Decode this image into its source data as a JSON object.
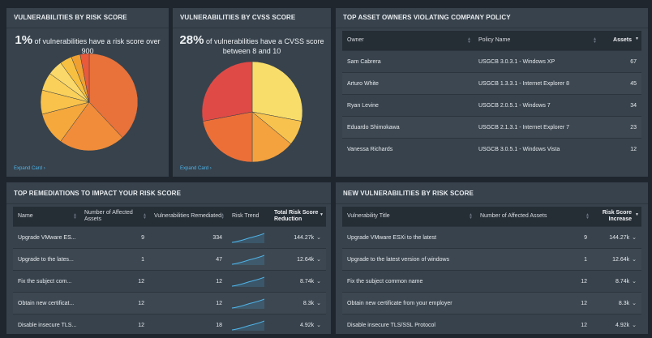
{
  "cards": {
    "risk_score": {
      "title": "VULNERABILITIES BY RISK SCORE",
      "stat_value": "1%",
      "stat_text": " of vulnerabilities have a risk score over 900",
      "expand_label": "Expand Card ›",
      "slices": [
        {
          "value": 38,
          "color": "#e8723a"
        },
        {
          "value": 22,
          "color": "#f08c3a"
        },
        {
          "value": 11,
          "color": "#f5a83c"
        },
        {
          "value": 8,
          "color": "#f9c24a"
        },
        {
          "value": 6,
          "color": "#fbd05a"
        },
        {
          "value": 5,
          "color": "#fbd86a"
        },
        {
          "value": 4,
          "color": "#f8c040"
        },
        {
          "value": 3,
          "color": "#f0a030"
        },
        {
          "value": 3,
          "color": "#e85a3a"
        }
      ]
    },
    "cvss_score": {
      "title": "VULNERABILITIES BY CVSS SCORE",
      "stat_value": "28%",
      "stat_text_line1": " of vulnerabilities have a CVSS score",
      "stat_text_line2": "between 8 and 10",
      "expand_label": "Expand Card ›",
      "slices": [
        {
          "value": 28,
          "color": "#f9dd6a"
        },
        {
          "value": 8,
          "color": "#f7c24e"
        },
        {
          "value": 14,
          "color": "#f4a23e"
        },
        {
          "value": 22,
          "color": "#ec6f38"
        },
        {
          "value": 28,
          "color": "#e04a46"
        }
      ]
    },
    "asset_owners": {
      "title": "TOP ASSET OWNERS VIOLATING COMPANY POLICY",
      "columns": [
        "Owner",
        "Policy Name",
        "Assets"
      ],
      "rows": [
        {
          "owner": "Sam Cabrera",
          "policy": "USGCB 3.0.3.1 - Windows XP",
          "assets": "67"
        },
        {
          "owner": "Arturo White",
          "policy": "USGCB 1.3.3.1 - Internet Explorer 8",
          "assets": "45"
        },
        {
          "owner": "Ryan Levine",
          "policy": "USGCB 2.0.5.1 - Windows 7",
          "assets": "34"
        },
        {
          "owner": "Eduardo Shimokawa",
          "policy": "USGCB 2.1.3.1 - Internet Explorer 7",
          "assets": "23"
        },
        {
          "owner": "Vanessa Richards",
          "policy": "USGCB 3.0.5.1 - Windows Vista",
          "assets": "12"
        }
      ]
    },
    "remediations": {
      "title": "TOP REMEDIATIONS TO IMPACT YOUR RISK SCORE",
      "columns": [
        "Name",
        "Number of Affected Assets",
        "Vulnerabilities Remediated",
        "Risk Trend",
        "Total Risk Score Reduction"
      ],
      "rows": [
        {
          "name": "Upgrade VMware ES...",
          "affected": "9",
          "remediated": "334",
          "reduction": "144.27k"
        },
        {
          "name": "Upgrade to the lates...",
          "affected": "1",
          "remediated": "47",
          "reduction": "12.64k"
        },
        {
          "name": "Fix the subject com...",
          "affected": "12",
          "remediated": "12",
          "reduction": "8.74k"
        },
        {
          "name": "Obtain new certificat...",
          "affected": "12",
          "remediated": "12",
          "reduction": "8.3k"
        },
        {
          "name": "Disable insecure TLS...",
          "affected": "12",
          "remediated": "18",
          "reduction": "4.92k"
        }
      ]
    },
    "new_vulns": {
      "title": "NEW VULNERABILITIES BY RISK SCORE",
      "columns": [
        "Vulnerability Title",
        "Number of Affected Assets",
        "Risk Score Increase"
      ],
      "rows": [
        {
          "title": "Upgrade VMware ESXi to the latest",
          "affected": "9",
          "increase": "144.27k"
        },
        {
          "title": "Upgrade to the latest version of windows",
          "affected": "1",
          "increase": "12.64k"
        },
        {
          "title": "Fix the subject common name",
          "affected": "12",
          "increase": "8.74k"
        },
        {
          "title": "Obtain new certificate from your employer",
          "affected": "12",
          "increase": "8.3k"
        },
        {
          "title": "Disable insecure TLS/SSL Protocol",
          "affected": "12",
          "increase": "4.92k"
        }
      ]
    }
  }
}
